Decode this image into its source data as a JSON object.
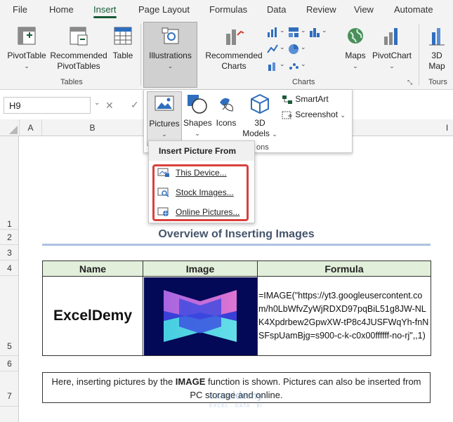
{
  "tabs": [
    "File",
    "Home",
    "Insert",
    "Page Layout",
    "Formulas",
    "Data",
    "Review",
    "View",
    "Automate"
  ],
  "active_tab": "Insert",
  "ribbon": {
    "pivottable": "PivotTable",
    "recommended_pivot_1": "Recommended",
    "recommended_pivot_2": "PivotTables",
    "table": "Table",
    "tables_group": "Tables",
    "illustrations": "Illustrations",
    "recommended_charts_1": "Recommended",
    "recommended_charts_2": "Charts",
    "maps": "Maps",
    "pivotchart": "PivotChart",
    "charts_group": "Charts",
    "map3d_1": "3D",
    "map3d_2": "Map",
    "tours_group": "Tours"
  },
  "illustrations_menu": {
    "pictures": "Pictures",
    "shapes": "Shapes",
    "icons": "Icons",
    "models_1": "3D",
    "models_2": "Models",
    "smartart": "SmartArt",
    "screenshot": "Screenshot",
    "group_label_partial": "ons"
  },
  "pictures_menu": {
    "header": "Insert Picture From",
    "items": [
      "This Device...",
      "Stock Images...",
      "Online Pictures..."
    ]
  },
  "formula_bar": {
    "name_box": "H9"
  },
  "columns": [
    "A",
    "B",
    "I"
  ],
  "rows": [
    "1",
    "2",
    "3",
    "4",
    "5",
    "6",
    "7"
  ],
  "sheet": {
    "title": "Overview of Inserting Images",
    "headers": [
      "Name",
      "Image",
      "Formula"
    ],
    "name": "ExcelDemy",
    "formula": "=IMAGE(\"https://yt3.googleusercontent.com/h0LbWfvZyWjRDXD97pqBiL51g8JW-NLK4Xpdrbew2GpwXW-tP8c4JUSFWqYh-fnNSFspUamBjg=s900-c-k-c0x00ffffff-no-rj\",,1)",
    "note_before": "Here, inserting pictures by the ",
    "note_bold": "IMAGE",
    "note_after": " function is shown. Pictures can also be inserted from PC storage and online."
  },
  "watermark": {
    "name": "exceldemy",
    "sub": "EXCEL · DATA · BI"
  },
  "colors": {
    "excel_green": "#185c37",
    "header_fill": "#e2efda",
    "highlight_red": "#d9413d",
    "title_blue": "#44546a"
  }
}
